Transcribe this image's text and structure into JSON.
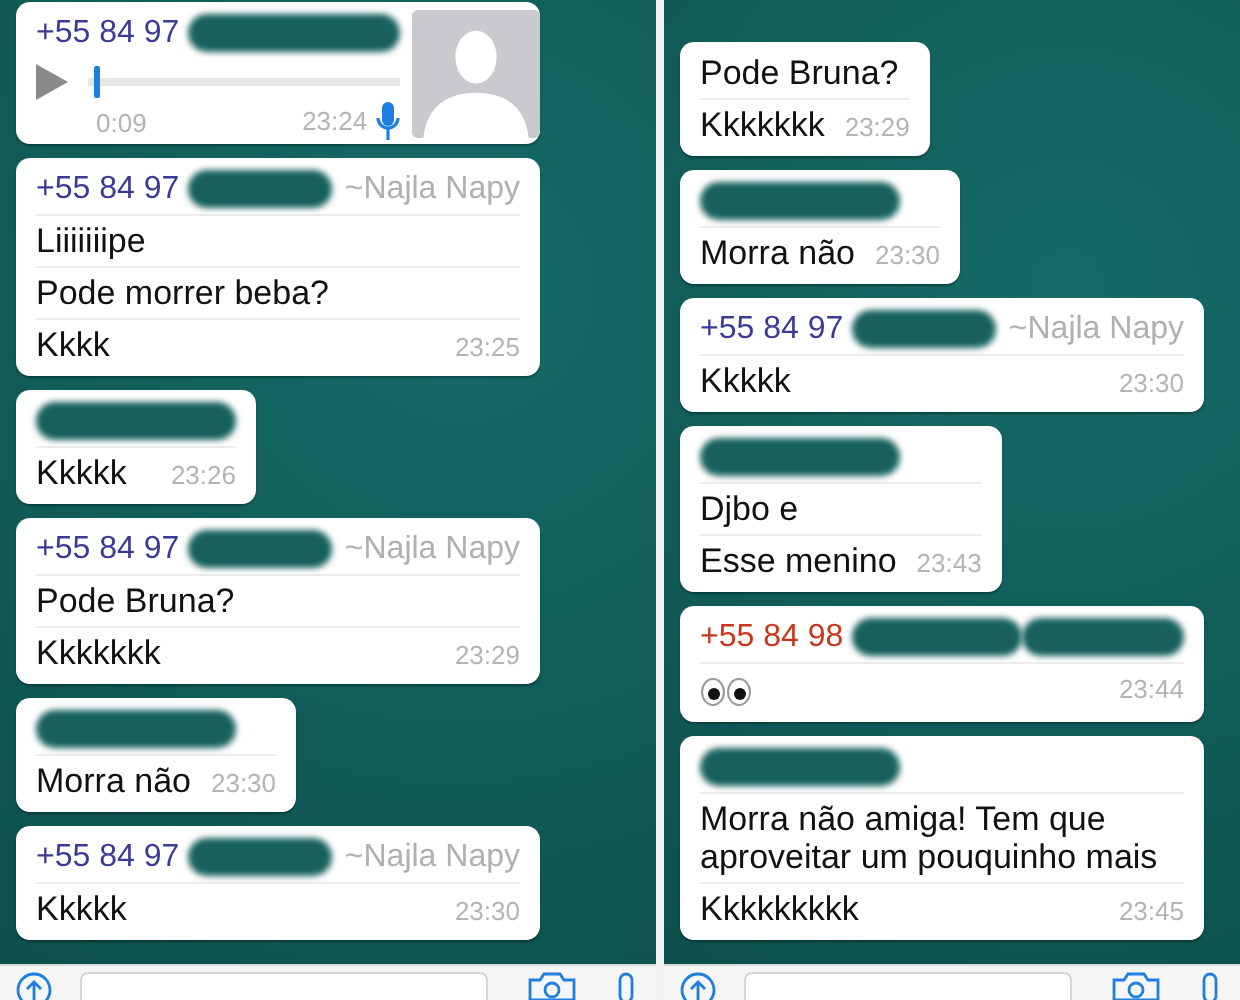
{
  "panels": [
    {
      "messages": [
        {
          "kind": "voice",
          "sender": {
            "phone": "+55 84 97",
            "color": "#3b3a98",
            "redacted": true
          },
          "level": 0.02,
          "duration": "0:09",
          "time": "23:24"
        },
        {
          "kind": "text",
          "sender": {
            "phone": "+55 84 97",
            "color": "#3b3a98",
            "redacted": true,
            "name": "~Najla Napy"
          },
          "lines": [
            "Liiiiiiipe",
            "Pode morrer beba?",
            "Kkkk"
          ],
          "time": "23:25"
        },
        {
          "kind": "text",
          "sender": {
            "redacted": true
          },
          "lines": [
            "Kkkkk"
          ],
          "time": "23:26"
        },
        {
          "kind": "text",
          "sender": {
            "phone": "+55 84 97",
            "color": "#3b3a98",
            "redacted": true,
            "name": "~Najla Napy"
          },
          "lines": [
            "Pode Bruna?",
            "Kkkkkkk"
          ],
          "time": "23:29"
        },
        {
          "kind": "text",
          "sender": {
            "redacted": true
          },
          "lines": [
            "Morra não"
          ],
          "time": "23:30"
        },
        {
          "kind": "text",
          "sender": {
            "phone": "+55 84 97",
            "color": "#3b3a98",
            "redacted": true,
            "name": "~Najla Napy"
          },
          "lines": [
            "Kkkkk"
          ],
          "time": "23:30"
        }
      ]
    },
    {
      "messages": [
        {
          "kind": "text",
          "lines": [
            "Pode Bruna?",
            "Kkkkkkk"
          ],
          "time": "23:29"
        },
        {
          "kind": "text",
          "sender": {
            "redacted": true
          },
          "lines": [
            "Morra não"
          ],
          "time": "23:30"
        },
        {
          "kind": "text",
          "sender": {
            "phone": "+55 84 97",
            "color": "#3b3a98",
            "redacted": true,
            "name": "~Najla Napy"
          },
          "lines": [
            "Kkkkk"
          ],
          "time": "23:30"
        },
        {
          "kind": "text",
          "sender": {
            "redacted": true
          },
          "lines": [
            "Djbo e",
            "Esse menino"
          ],
          "time": "23:43"
        },
        {
          "kind": "eyes",
          "sender": {
            "phone": "+55 84 98",
            "color": "#c8361c",
            "redacted": true,
            "name_redacted": true
          },
          "time": "23:44"
        },
        {
          "kind": "text",
          "sender": {
            "redacted": true
          },
          "lines": [
            "Morra não amiga! Tem que aproveitar um pouquinho mais",
            "Kkkkkkkkk"
          ],
          "time": "23:45"
        }
      ]
    }
  ]
}
